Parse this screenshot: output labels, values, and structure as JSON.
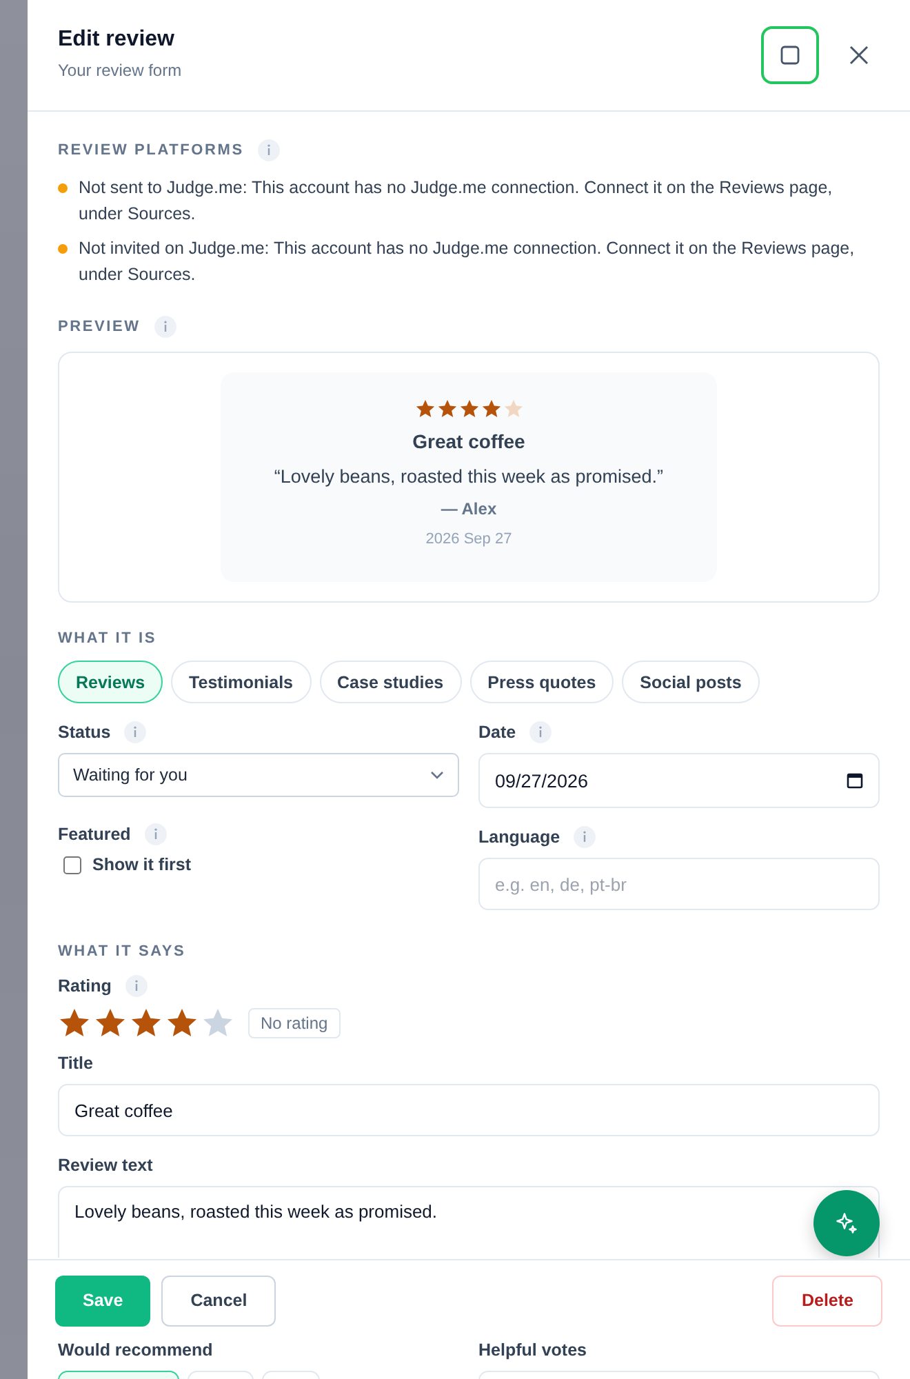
{
  "drawer": {
    "title": "Edit review",
    "subtitle": "Your review form"
  },
  "platforms": {
    "heading": "REVIEW PLATFORMS",
    "notices": [
      {
        "text": "Not sent to Judge.me: This account has no Judge.me connection. Connect it on the Reviews page, under Sources.",
        "color": "#f59e0b"
      },
      {
        "text": "Not invited on Judge.me: This account has no Judge.me connection. Connect it on the Reviews page, under Sources.",
        "color": "#f59e0b"
      }
    ]
  },
  "preview": {
    "heading": "PREVIEW",
    "stars": 4,
    "title": "Great coffee",
    "quote": "“Lovely beans, roasted this week as promised.”",
    "author": "— Alex",
    "date": "2026 Sep 27"
  },
  "what_it_is": {
    "heading": "WHAT IT IS",
    "types": [
      {
        "label": "Reviews",
        "selected": true
      },
      {
        "label": "Testimonials",
        "selected": false
      },
      {
        "label": "Case studies",
        "selected": false
      },
      {
        "label": "Press quotes",
        "selected": false
      },
      {
        "label": "Social posts",
        "selected": false
      }
    ]
  },
  "status": {
    "label": "Status",
    "value": "Waiting for you"
  },
  "date": {
    "label": "Date",
    "value": "09/27/2026"
  },
  "featured": {
    "label": "Featured",
    "option": "Show it first",
    "checked": false
  },
  "language": {
    "label": "Language",
    "placeholder": "e.g. en, de, pt-br"
  },
  "what_it_says": {
    "heading": "WHAT IT SAYS"
  },
  "rating": {
    "label": "Rating",
    "stars": 4,
    "clear": "No rating"
  },
  "title_field": {
    "label": "Title",
    "value": "Great coffee"
  },
  "review_text": {
    "label": "Review text",
    "value": "Lovely beans, roasted this week as promised."
  },
  "footer": {
    "save": "Save",
    "cancel": "Cancel",
    "delete": "Delete"
  },
  "would_recommend": {
    "label": "Would recommend",
    "options": [
      {
        "selected": true
      },
      {
        "selected": false
      },
      {
        "selected": false
      }
    ]
  },
  "helpful_votes": {
    "label": "Helpful votes"
  }
}
